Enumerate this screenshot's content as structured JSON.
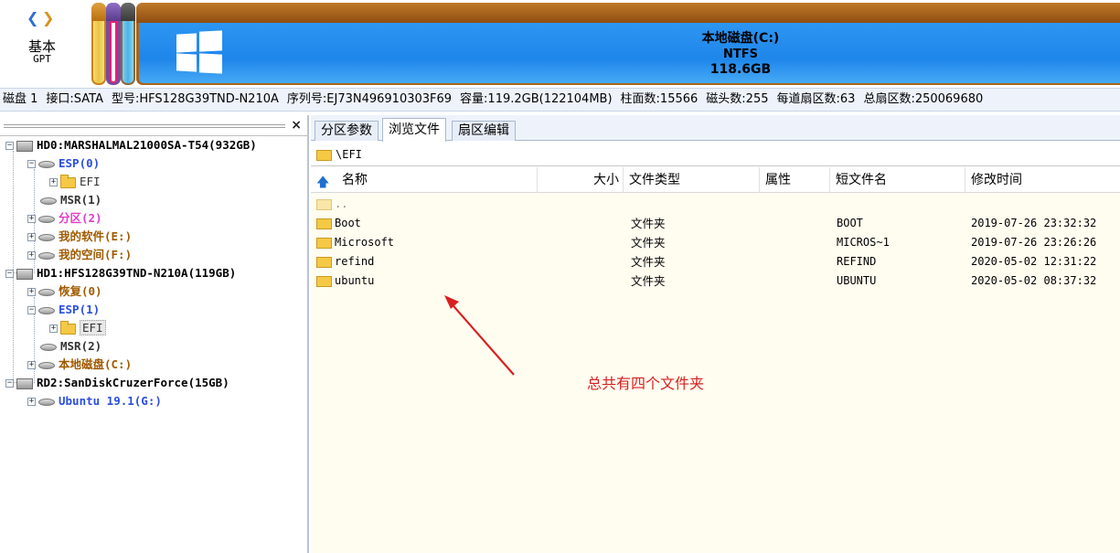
{
  "disk_nav": {
    "disk_type": "基本",
    "disk_style": "GPT"
  },
  "main_partition": {
    "name": "本地磁盘(C:)",
    "fs": "NTFS",
    "size": "118.6GB"
  },
  "disk_info": {
    "disk": "磁盘 1",
    "interface": "接口:SATA",
    "model": "型号:HFS128G39TND-N210A",
    "serial": "序列号:EJ73N496910303F69",
    "capacity": "容量:119.2GB(122104MB)",
    "cylinders": "柱面数:15566",
    "heads": "磁头数:255",
    "sectors_per_track": "每道扇区数:63",
    "total_sectors": "总扇区数:250069680"
  },
  "tree": {
    "close_label": "×",
    "items": [
      {
        "label": "HD0:MARSHALMAL21000SA-T54(932GB)"
      },
      {
        "label": "ESP(0)"
      },
      {
        "label": "EFI"
      },
      {
        "label": "MSR(1)"
      },
      {
        "label": "分区(2)"
      },
      {
        "label": "我的软件(E:)"
      },
      {
        "label": "我的空间(F:)"
      },
      {
        "label": "HD1:HFS128G39TND-N210A(119GB)"
      },
      {
        "label": "恢复(0)"
      },
      {
        "label": "ESP(1)"
      },
      {
        "label": "EFI"
      },
      {
        "label": "MSR(2)"
      },
      {
        "label": "本地磁盘(C:)"
      },
      {
        "label": "RD2:SanDiskCruzerForce(15GB)"
      },
      {
        "label": "Ubuntu 19.1(G:)"
      }
    ]
  },
  "tabs": [
    {
      "label": "分区参数"
    },
    {
      "label": "浏览文件"
    },
    {
      "label": "扇区编辑"
    }
  ],
  "path": "\\EFI",
  "columns": {
    "name": "名称",
    "size": "大小",
    "type": "文件类型",
    "attr": "属性",
    "short": "短文件名",
    "modified": "修改时间"
  },
  "files": [
    {
      "name": "..",
      "type": "",
      "short": "",
      "modified": ""
    },
    {
      "name": "Boot",
      "type": "文件夹",
      "short": "BOOT",
      "modified": "2019-07-26 23:32:32"
    },
    {
      "name": "Microsoft",
      "type": "文件夹",
      "short": "MICROS~1",
      "modified": "2019-07-26 23:26:26"
    },
    {
      "name": "refind",
      "type": "文件夹",
      "short": "REFIND",
      "modified": "2020-05-02 12:31:22"
    },
    {
      "name": "ubuntu",
      "type": "文件夹",
      "short": "UBUNTU",
      "modified": "2020-05-02 08:37:32"
    }
  ],
  "annotation": {
    "text": "总共有四个文件夹",
    "color": "#d82020"
  }
}
